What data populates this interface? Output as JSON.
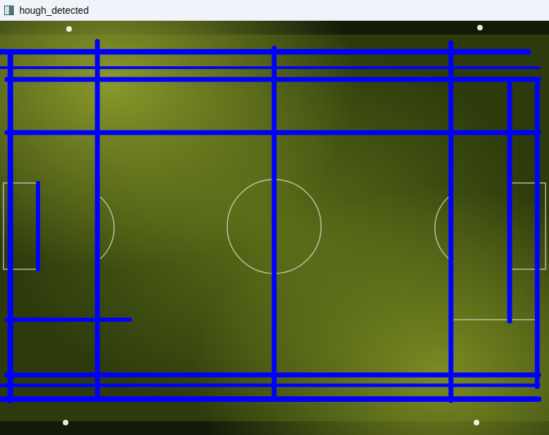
{
  "window": {
    "title": "hough_detected"
  }
}
